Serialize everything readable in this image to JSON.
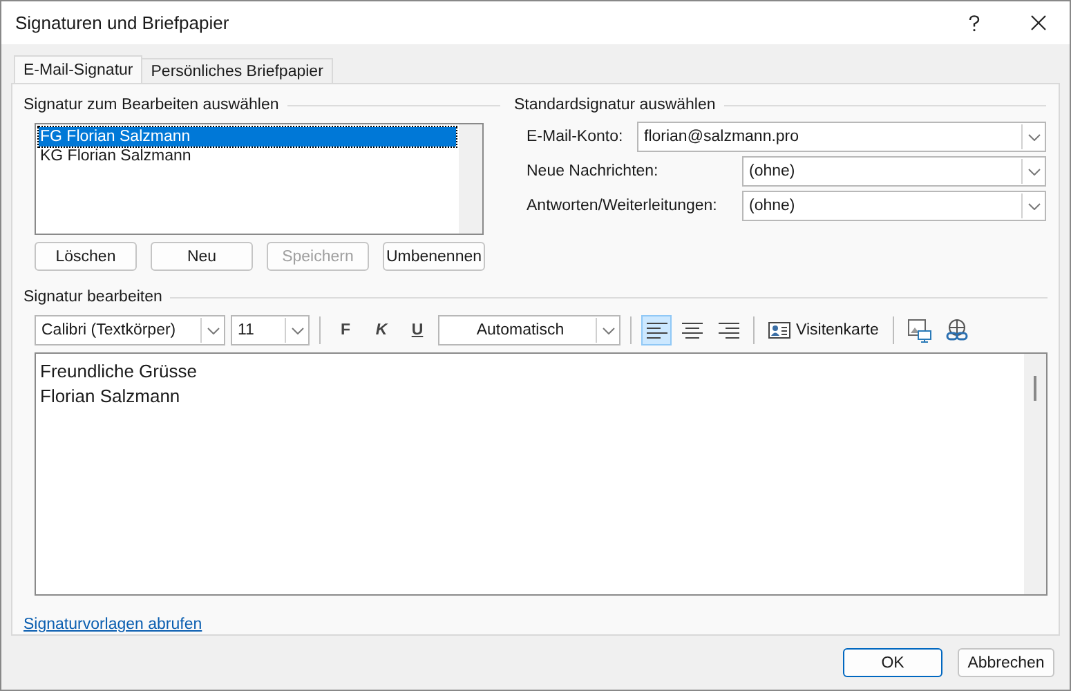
{
  "window": {
    "title": "Signaturen und Briefpapier"
  },
  "tabs": [
    {
      "label": "E-Mail-Signatur",
      "selected": true
    },
    {
      "label": "Persönliches Briefpapier",
      "selected": false
    }
  ],
  "select_group": {
    "heading": "Signatur zum Bearbeiten auswählen",
    "items": [
      {
        "label": "FG Florian Salzmann",
        "selected": true
      },
      {
        "label": "KG Florian Salzmann",
        "selected": false
      }
    ],
    "buttons": [
      {
        "label": "Löschen",
        "disabled": false
      },
      {
        "label": "Neu",
        "disabled": false
      },
      {
        "label": "Speichern",
        "disabled": true
      },
      {
        "label": "Umbenennen",
        "disabled": false
      }
    ]
  },
  "default_group": {
    "heading": "Standardsignatur auswählen",
    "fields": [
      {
        "label": "E-Mail-Konto:",
        "value": "florian@salzmann.pro"
      },
      {
        "label": "Neue Nachrichten:",
        "value": "(ohne)"
      },
      {
        "label": "Antworten/Weiterleitungen:",
        "value": "(ohne)"
      }
    ]
  },
  "editor": {
    "heading": "Signatur bearbeiten",
    "font": "Calibri (Textkörper)",
    "size": "11",
    "bold": "F",
    "italic": "K",
    "underline": "U",
    "text_color": "Automatisch",
    "align": [
      {
        "kind": "left",
        "selected": true
      },
      {
        "kind": "center",
        "selected": false
      },
      {
        "kind": "right",
        "selected": false
      }
    ],
    "business_card": "Visitenkarte",
    "lines": [
      "Freundliche Grüsse",
      "Florian Salzmann"
    ]
  },
  "link": "Signaturvorlagen abrufen",
  "buttons": [
    {
      "label": "OK",
      "default": true
    },
    {
      "label": "Abbrechen",
      "default": false
    }
  ]
}
